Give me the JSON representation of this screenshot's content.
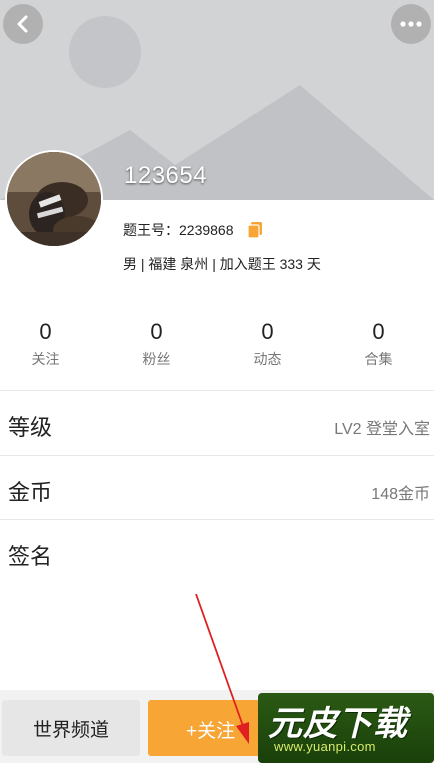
{
  "header": {
    "back_icon": "chevron-left-icon",
    "more_icon": "more-dots-icon"
  },
  "profile": {
    "username": "123654",
    "id_line": "题王号：2239868",
    "info": "男 | 福建 泉州 | 加入题王 333 天"
  },
  "stats": [
    {
      "value": "0",
      "label": "关注"
    },
    {
      "value": "0",
      "label": "粉丝"
    },
    {
      "value": "0",
      "label": "动态"
    },
    {
      "value": "0",
      "label": "合集"
    }
  ],
  "rows": {
    "level": {
      "label": "等级",
      "value": "LV2 登堂入室"
    },
    "coins": {
      "label": "金币",
      "value": "148金币"
    },
    "signature": {
      "label": "签名",
      "value": ""
    }
  },
  "bottom": {
    "channel_label": "世界频道",
    "follow_label": "+关注"
  },
  "watermark": {
    "title": "元皮下载",
    "url": "www.yuanpi.com"
  },
  "colors": {
    "accent": "#f7a535",
    "copy_icon": "#f7a535",
    "annotation_arrow": "#e02020"
  }
}
